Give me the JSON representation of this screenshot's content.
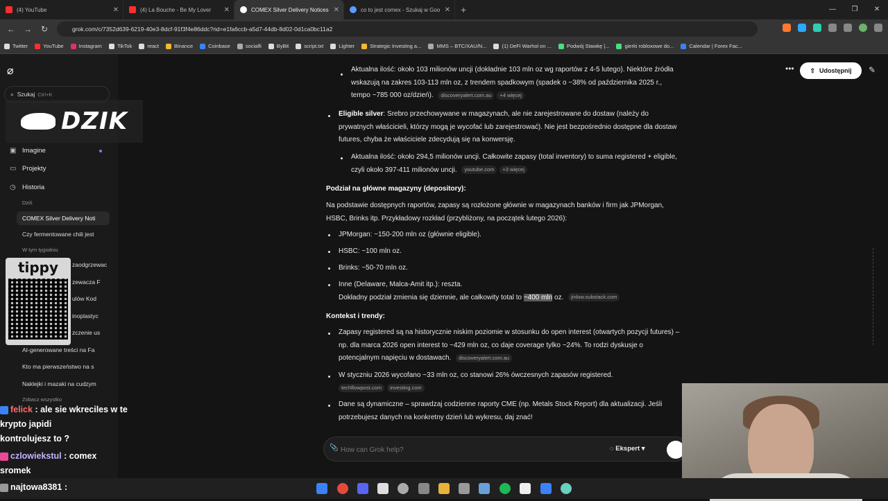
{
  "browser": {
    "tabs": [
      {
        "label": "(4) YouTube",
        "color": "#ff2e2e"
      },
      {
        "label": "(4) La Bouche - Be My Lover",
        "color": "#ff2e2e"
      },
      {
        "label": "COMEX Silver Delivery Notices",
        "color": "#ffffff",
        "active": true
      },
      {
        "label": "co to jest comex - Szukaj w Goo",
        "color": "#5b9bff"
      }
    ],
    "url": "grok.com/c/7352d639-6219-40e3-8dcf-91f3f4e86ddc?rid=e1fa6ccb-a5d7-44db-8d02-0d1ca0bc11a2",
    "bookmarks": [
      {
        "label": "Twitter",
        "color": "#dddddd"
      },
      {
        "label": "YouTube",
        "color": "#ff2e2e"
      },
      {
        "label": "Instagram",
        "color": "#e1306c"
      },
      {
        "label": "TikTok",
        "color": "#dddddd"
      },
      {
        "label": "react",
        "color": "#dddddd"
      },
      {
        "label": "Binance",
        "color": "#f3ba2f"
      },
      {
        "label": "Coinbase",
        "color": "#3b82f6"
      },
      {
        "label": "socialfi",
        "color": "#aaaaaa"
      },
      {
        "label": "ByBit",
        "color": "#dddddd"
      },
      {
        "label": "script.txt",
        "color": "#dddddd"
      },
      {
        "label": "Lighter",
        "color": "#dddddd"
      },
      {
        "label": "Strategic Investing a...",
        "color": "#f3ba2f"
      },
      {
        "label": "MMS – BTC/XAU/N...",
        "color": "#aaaaaa"
      },
      {
        "label": "(1) DeFi Warhol on ...",
        "color": "#dddddd"
      },
      {
        "label": "Podwój Stawkę |...",
        "color": "#4ade80"
      },
      {
        "label": "gierki robloxowe do...",
        "color": "#4ade80"
      },
      {
        "label": "Calendar | Forex Fac...",
        "color": "#3b82f6"
      }
    ]
  },
  "sidebar": {
    "search_label": "Szukaj",
    "search_hint": "Ctrl+K",
    "overlay_brand": "DZIK",
    "tippy_label": "tippy",
    "nav": [
      {
        "label": "Imagine",
        "icon": "image-icon"
      },
      {
        "label": "Projekty",
        "icon": "folder-icon"
      },
      {
        "label": "Historia",
        "icon": "history-icon"
      }
    ],
    "section_today": "Dziś",
    "section_week": "W tym tygodniu",
    "history": [
      "COMEX Silver Delivery Noti",
      "Czy fermentowane chili jest",
      "zaodgrzewac",
      "zewacza F",
      "ulów Kod",
      "inoplastyc",
      "zczenie us",
      "AI-generowane treści na Fa",
      "Kto ma pierwszeństwo na s",
      "Naklejki i mazaki na cudzym"
    ],
    "see_all": "Zobacz wszystko"
  },
  "stream_chat": [
    {
      "user": "felick",
      "text": ": ale sie wkreciles w te krypto japidi",
      "line2": "kontrolujesz to ?"
    },
    {
      "user": "czlowiekstul",
      "text": ": comex",
      "line2": "sromek"
    },
    {
      "user": "najtowa8381",
      "text": ":"
    }
  ],
  "header": {
    "share_label": "Udostępnij"
  },
  "content": {
    "b1": "Aktualna ilość: około 103 milionów uncji (dokładnie 103 mln oz wg raportów z 4-5 lutego). Niektóre źródła wskazują na zakres 103-113 mln oz, z trendem spadkowym (spadek o ~38% od października 2025 r., tempo ~785 000 oz/dzień).",
    "b1_src": "discoveryalert.com.au",
    "b1_more": "+4 więcej",
    "b2_title": "Eligible silver",
    "b2_text": ": Srebro przechowywane w magazynach, ale nie zarejestrowane do dostaw (należy do prywatnych właścicieli, którzy mogą je wycofać lub zarejestrować). Nie jest bezpośrednio dostępne dla dostaw futures, chyba że właściciele zdecydują się na konwersję.",
    "b3": "Aktualna ilość: około 294,5 milionów uncji. Całkowite zapasy (total inventory) to suma registered + eligible, czyli około 397-411 milionów uncji.",
    "b3_src": "youtube.com",
    "b3_more": "+3 więcej",
    "h1": "Podział na główne magazyny (depository):",
    "p1": "Na podstawie dostępnych raportów, zapasy są rozłożone głównie w magazynach banków i firm jak JPMorgan, HSBC, Brinks itp. Przykładowy rozkład (przybliżony, na początek lutego 2026):",
    "l1": "JPMorgan: ~150-200 mln oz (głównie eligible).",
    "l2": "HSBC: ~100 mln oz.",
    "l3": "Brinks: ~50-70 mln oz.",
    "l4": "Inne (Delaware, Malca-Amit itp.): reszta.",
    "l4b_pre": "Dokładny podział zmienia się dziennie, ale całkowity total to ",
    "l4b_hl": "~400 mln",
    "l4b_post": " oz.",
    "l4b_src": "jinlow.substack.com",
    "h2": "Kontekst i trendy:",
    "k1": "Zapasy registered są na historycznie niskim poziomie w stosunku do open interest (otwartych pozycji futures) – np. dla marca 2026 open interest to ~429 mln oz, co daje coverage tylko ~24%. To rodzi dyskusje o potencjalnym napięciu w dostawach.",
    "k1_src": "discoveryalert.com.au",
    "k2": "W styczniu 2026 wycofano ~33 mln oz, co stanowi 26% ówczesnych zapasów registered.",
    "k2_src1": "techflowpost.com",
    "k2_src2": "investing.com",
    "k3": "Dane są dynamiczne – sprawdzaj codzienne raporty CME (np. Metals Stock Report) dla aktualizacji. Jeśli potrzebujesz danych na konkretny dzień lub wykresu, daj znać!"
  },
  "composer": {
    "placeholder": "How can Grok help?",
    "mode_label": "Ekspert"
  }
}
